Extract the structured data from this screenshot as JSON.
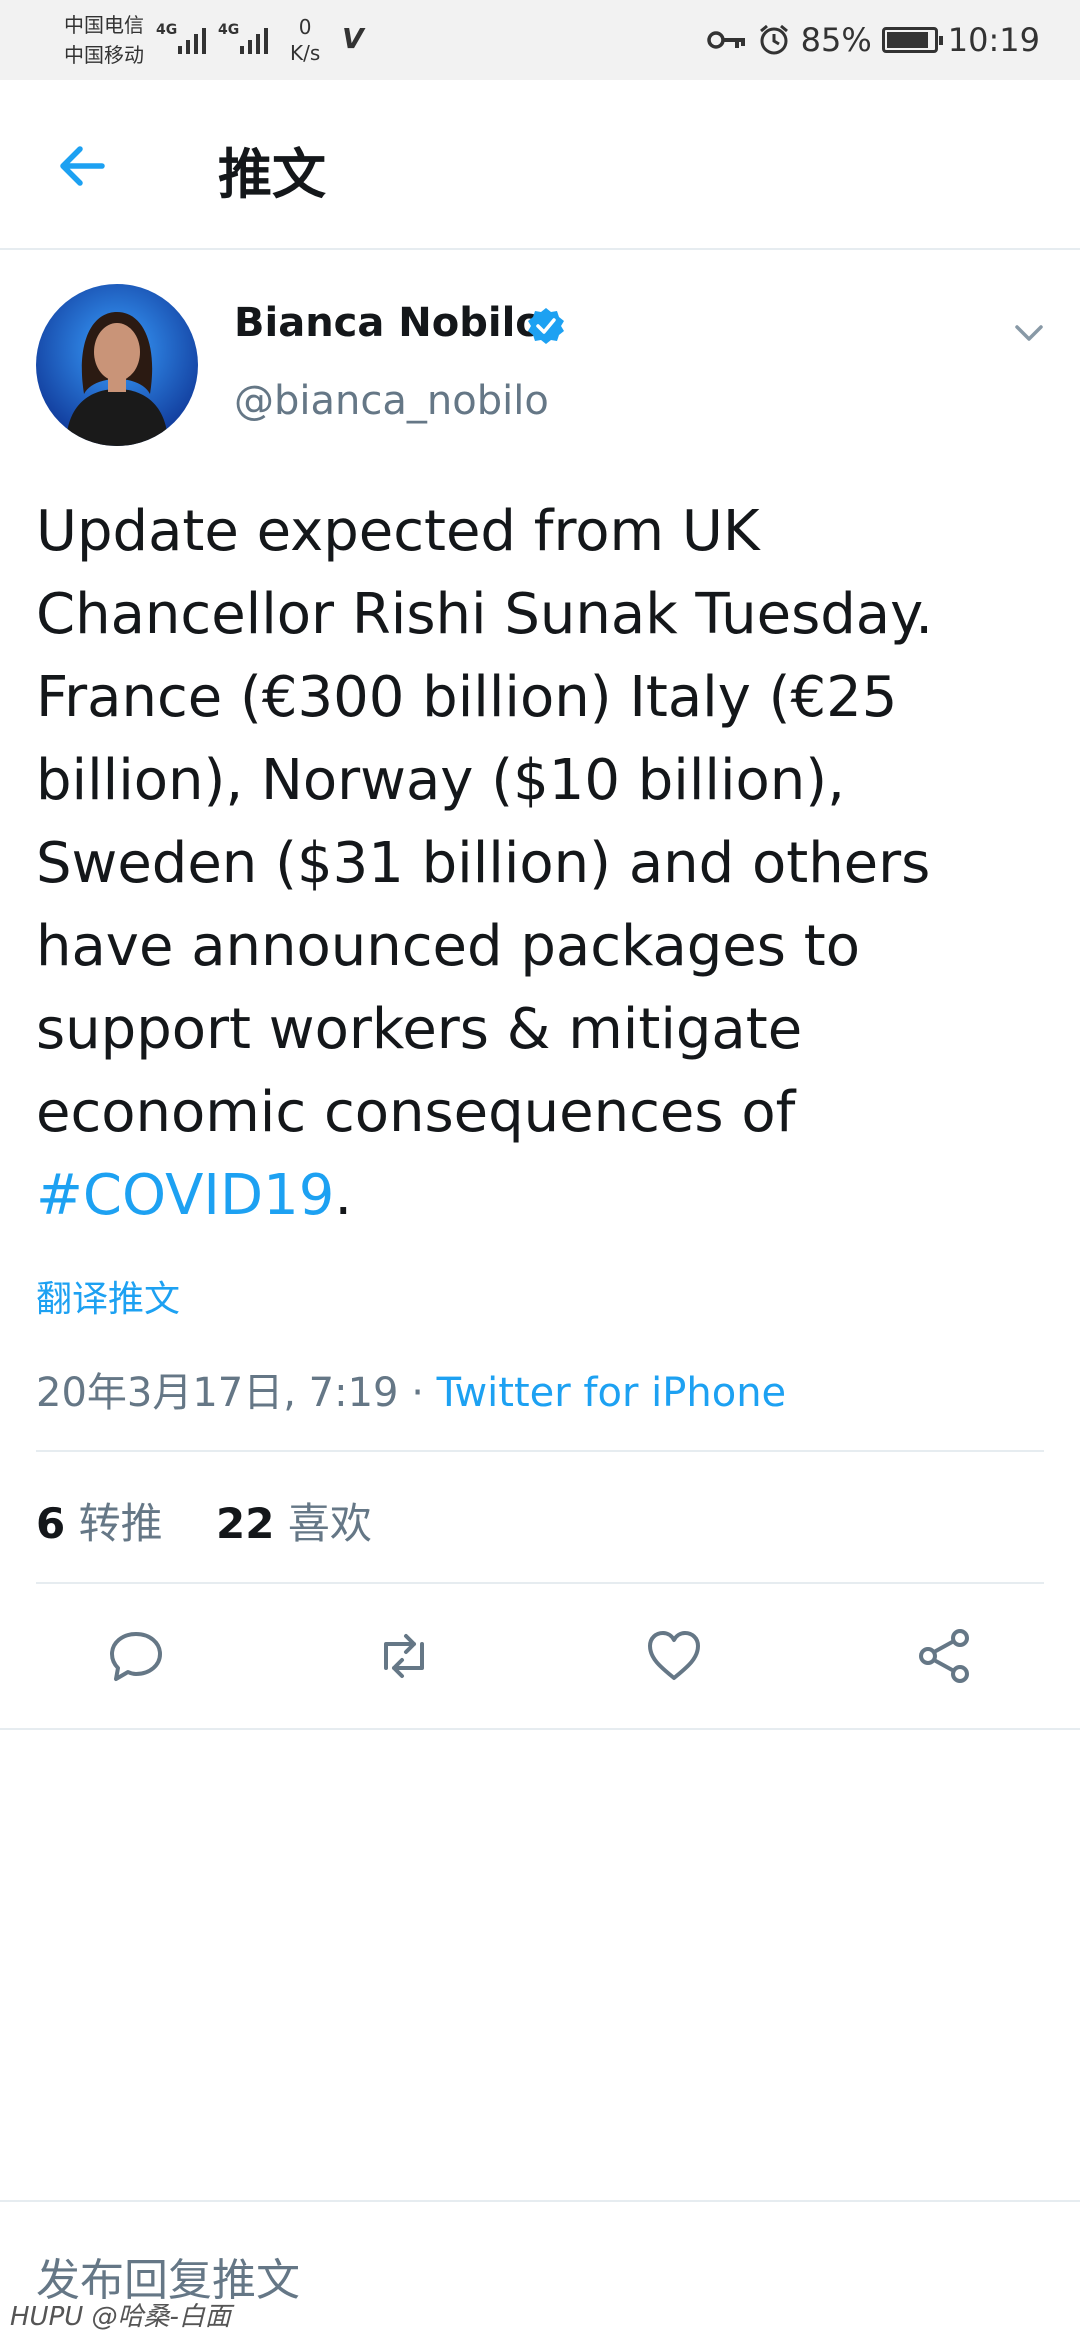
{
  "status_bar": {
    "carrier1": "中国电信",
    "carrier2": "中国移动",
    "network1": "4G",
    "network2": "4G",
    "speed_value": "0",
    "speed_unit": "K/s",
    "battery": "85%",
    "time": "10:19"
  },
  "header": {
    "title": "推文",
    "back_icon": "back-arrow-icon"
  },
  "tweet": {
    "author_name": "Bianca Nobilo",
    "handle": "@bianca_nobilo",
    "text": "Update expected from UK Chancellor Rishi Sunak Tuesday. France (€300 billion) Italy (€25 billion), Norway ($10 billion), Sweden ($31 billion) and others have announced packages to support workers & mitigate economic consequences of ",
    "hashtag": "#COVID19",
    "text_end": ".",
    "translate": "翻译推文",
    "timestamp": "20年3月17日, 7:19",
    "separator": " · ",
    "source": "Twitter for iPhone",
    "retweets_count": "6",
    "retweets_label": "转推",
    "likes_count": "22",
    "likes_label": "喜欢"
  },
  "actions": [
    "reply-icon",
    "retweet-icon",
    "like-icon",
    "share-icon"
  ],
  "reply_bar": {
    "placeholder": "发布回复推文"
  },
  "watermark": "HUPU @哈桑-白面",
  "colors": {
    "accent": "#1da1f2",
    "text": "#14171a",
    "secondary": "#657786",
    "divider": "#e6ecf0"
  }
}
